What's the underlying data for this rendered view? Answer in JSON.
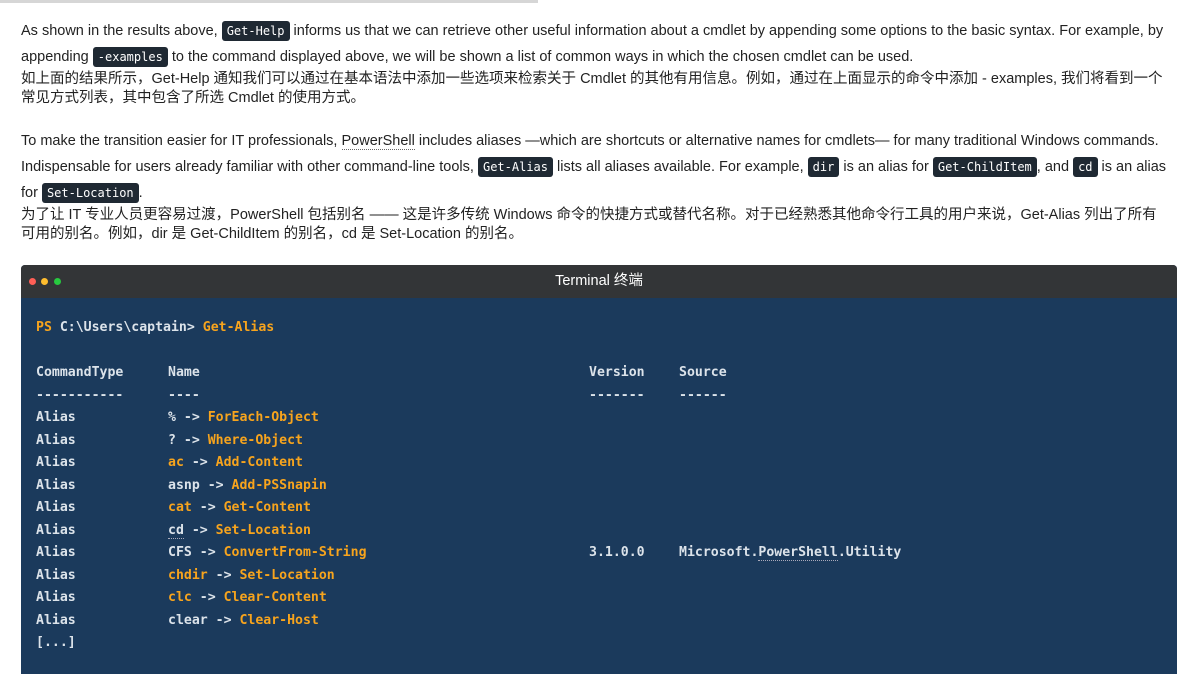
{
  "article": {
    "para1": {
      "t1": "As shown in the results above, ",
      "c1": "Get-Help",
      "t2": " informs us that we can retrieve other useful information about a cmdlet by appending some options to the basic syntax. For example, by appending ",
      "c2": "-examples",
      "t3": " to the command displayed above, we will be shown a list of common ways in which the chosen cmdlet can be used."
    },
    "para1_zh": "如上面的结果所示，Get-Help 通知我们可以通过在基本语法中添加一些选项来检索关于 Cmdlet 的其他有用信息。例如，通过在上面显示的命令中添加 - examples, 我们将看到一个常见方式列表，其中包含了所选 Cmdlet 的使用方式。",
    "para2": {
      "t1": "To make the transition easier for IT professionals, ",
      "ps": "PowerShell",
      "t2": " includes aliases —which are shortcuts or alternative names for cmdlets— for many traditional Windows commands. Indispensable for users already familiar with other command-line tools, ",
      "c1": "Get-Alias",
      "t3": " lists all aliases available. For example, ",
      "c2": "dir",
      "t4": " is an alias for ",
      "c3": "Get-ChildItem",
      "t5": ", and ",
      "c4": "cd",
      "t6": " is an alias for ",
      "c5": "Set-Location",
      "t7": "."
    },
    "para2_zh": "为了让 IT 专业人员更容易过渡，PowerShell 包括别名 —— 这是许多传统 Windows 命令的快捷方式或替代名称。对于已经熟悉其他命令行工具的用户来说，Get-Alias 列出了所有可用的别名。例如，dir 是 Get-ChildItem 的别名，cd 是 Set-Location 的别名。"
  },
  "terminal": {
    "title": "Terminal  终端",
    "prompt_ps": "PS",
    "prompt_path": "C:\\Users\\captain>",
    "command": "Get-Alias",
    "headers": {
      "type": "CommandType",
      "name": "Name",
      "version": "Version",
      "source": "Source"
    },
    "dashes": {
      "type": "-----------",
      "name": "----",
      "version": "-------",
      "source": "------"
    },
    "rows": [
      {
        "type": "Alias",
        "alias": "%",
        "target": "ForEach-Object",
        "version": "",
        "source": ""
      },
      {
        "type": "Alias",
        "alias": "?",
        "target": "Where-Object",
        "version": "",
        "source": ""
      },
      {
        "type": "Alias",
        "alias": "ac",
        "target": "Add-Content",
        "version": "",
        "source": ""
      },
      {
        "type": "Alias",
        "alias": "asnp",
        "target": "Add-PSSnapin",
        "version": "",
        "source": ""
      },
      {
        "type": "Alias",
        "alias": "cat",
        "target": "Get-Content",
        "version": "",
        "source": ""
      },
      {
        "type": "Alias",
        "alias": "cd",
        "target": "Set-Location",
        "version": "",
        "source": ""
      },
      {
        "type": "Alias",
        "alias": "CFS",
        "target": "ConvertFrom-String",
        "version": "3.1.0.0",
        "source": "Microsoft.PowerShell.Utility"
      },
      {
        "type": "Alias",
        "alias": "chdir",
        "target": "Set-Location",
        "version": "",
        "source": ""
      },
      {
        "type": "Alias",
        "alias": "clc",
        "target": "Clear-Content",
        "version": "",
        "source": ""
      },
      {
        "type": "Alias",
        "alias": "clear",
        "target": "Clear-Host",
        "version": "",
        "source": ""
      }
    ],
    "ellipsis": "[...]"
  }
}
